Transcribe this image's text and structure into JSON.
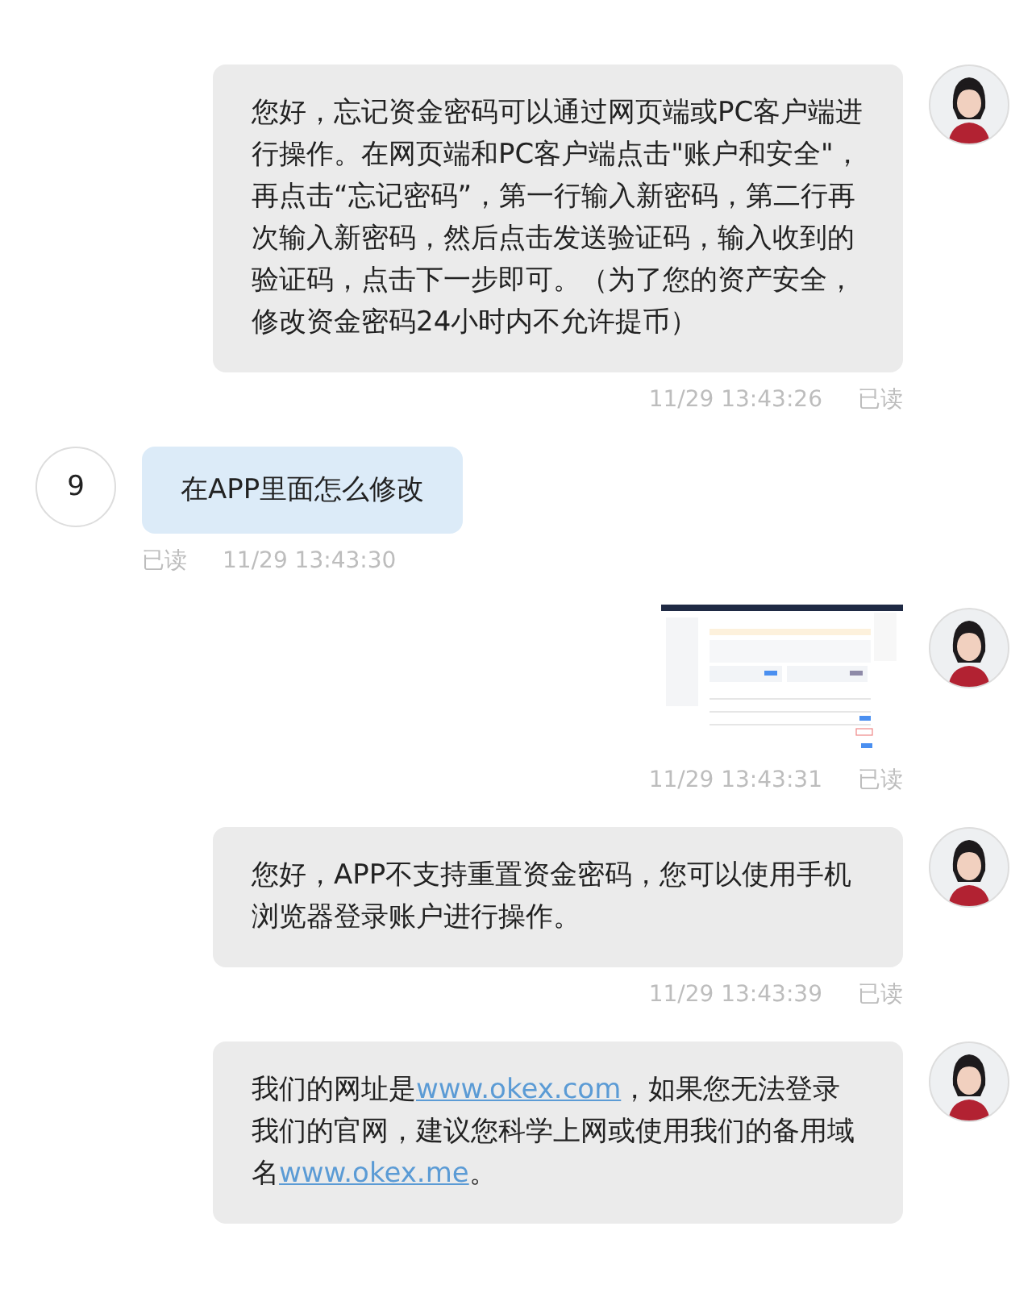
{
  "messages": [
    {
      "outgoing": true,
      "kind": "text",
      "parts": [
        {
          "kind": "text",
          "text": "您好，忘记资金密码可以通过网页端或PC客户端进行操作。在网页端和PC客户端点击\"账户和安全\"，再点击“忘记密码”，第一行输入新密码，第二行再次输入新密码，然后点击发送验证码，输入收到的验证码，点击下一步即可。（为了您的资产安全，修改资金密码24小时内不允许提币）"
        }
      ],
      "time": "11/29 13:43:26",
      "read": "已读"
    },
    {
      "outgoing": false,
      "avatar_text": "9",
      "kind": "text",
      "parts": [
        {
          "kind": "text",
          "text": "在APP里面怎么修改"
        }
      ],
      "time": "11/29 13:43:30",
      "read": "已读"
    },
    {
      "outgoing": true,
      "kind": "picture",
      "time": "11/29 13:43:31",
      "read": "已读"
    },
    {
      "outgoing": true,
      "kind": "text",
      "parts": [
        {
          "kind": "text",
          "text": "您好，APP不支持重置资金密码，您可以使用手机浏览器登录账户进行操作。"
        }
      ],
      "time": "11/29 13:43:39",
      "read": "已读"
    },
    {
      "outgoing": true,
      "kind": "text",
      "parts": [
        {
          "kind": "text",
          "text": "我们的网址是"
        },
        {
          "kind": "link",
          "text": "www.okex.com"
        },
        {
          "kind": "text",
          "text": "，如果您无法登录我们的官网，建议您科学上网或使用我们的备用域名"
        },
        {
          "kind": "link",
          "text": "www.okex.me"
        },
        {
          "kind": "text",
          "text": "。"
        }
      ]
    }
  ]
}
